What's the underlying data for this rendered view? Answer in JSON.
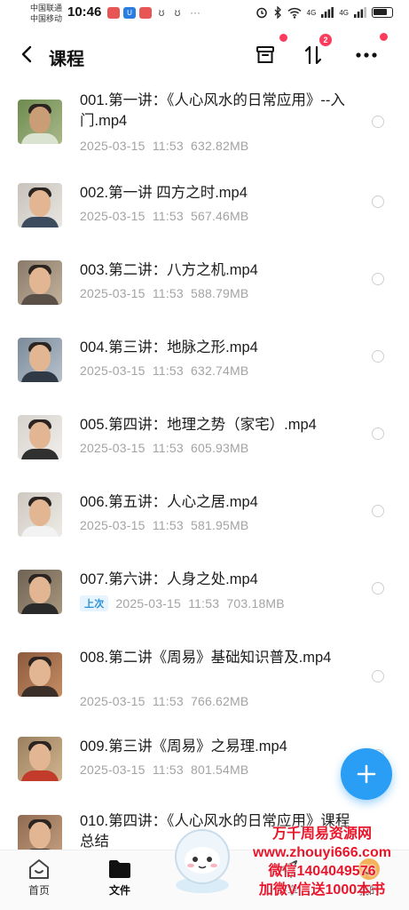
{
  "status_bar": {
    "carrier_1": "中国联通",
    "carrier_2": "中国移动",
    "time": "10:46",
    "signal_1": "4G",
    "signal_2": "4G"
  },
  "header": {
    "title": "课程",
    "sort_badge": "2"
  },
  "files": [
    {
      "name": "001.第一讲：《人心风水的日常应用》--入门.mp4",
      "date": "2025-03-15",
      "time": "11:53",
      "size": "632.82MB",
      "last": ""
    },
    {
      "name": "002.第一讲 四方之时.mp4",
      "date": "2025-03-15",
      "time": "11:53",
      "size": "567.46MB",
      "last": ""
    },
    {
      "name": "003.第二讲：八方之机.mp4",
      "date": "2025-03-15",
      "time": "11:53",
      "size": "588.79MB",
      "last": ""
    },
    {
      "name": "004.第三讲：地脉之形.mp4",
      "date": "2025-03-15",
      "time": "11:53",
      "size": "632.74MB",
      "last": ""
    },
    {
      "name": "005.第四讲：地理之势（家宅）.mp4",
      "date": "2025-03-15",
      "time": "11:53",
      "size": "605.93MB",
      "last": ""
    },
    {
      "name": "006.第五讲：人心之居.mp4",
      "date": "2025-03-15",
      "time": "11:53",
      "size": "581.95MB",
      "last": ""
    },
    {
      "name": "007.第六讲：人身之处.mp4",
      "date": "2025-03-15",
      "time": "11:53",
      "size": "703.18MB",
      "last": "上次"
    },
    {
      "name": "008.第二讲《周易》基础知识普及.mp4",
      "date": "2025-03-15",
      "time": "11:53",
      "size": "766.62MB",
      "last": ""
    },
    {
      "name": "009.第三讲《周易》之易理.mp4",
      "date": "2025-03-15",
      "time": "11:53",
      "size": "801.54MB",
      "last": ""
    },
    {
      "name": "010.第四讲：《人心风水的日常应用》课程总结",
      "date": "",
      "time": "",
      "size": "",
      "last": ""
    }
  ],
  "bottom_nav": [
    {
      "label": "首页",
      "icon": "home-icon"
    },
    {
      "label": "文件",
      "icon": "folder-icon"
    },
    {
      "label": "共享",
      "icon": "share-icon"
    },
    {
      "label": "我的",
      "icon": "profile-icon"
    }
  ],
  "watermark": {
    "line1": "万千周易资源网",
    "line2": "www.zhouyi666.com",
    "line3": "微信1404049576",
    "line4": "加微V信送1000本书"
  },
  "colors": {
    "accent": "#2a9df4",
    "badge": "#ff3b5c",
    "watermark": "#e8162b"
  }
}
